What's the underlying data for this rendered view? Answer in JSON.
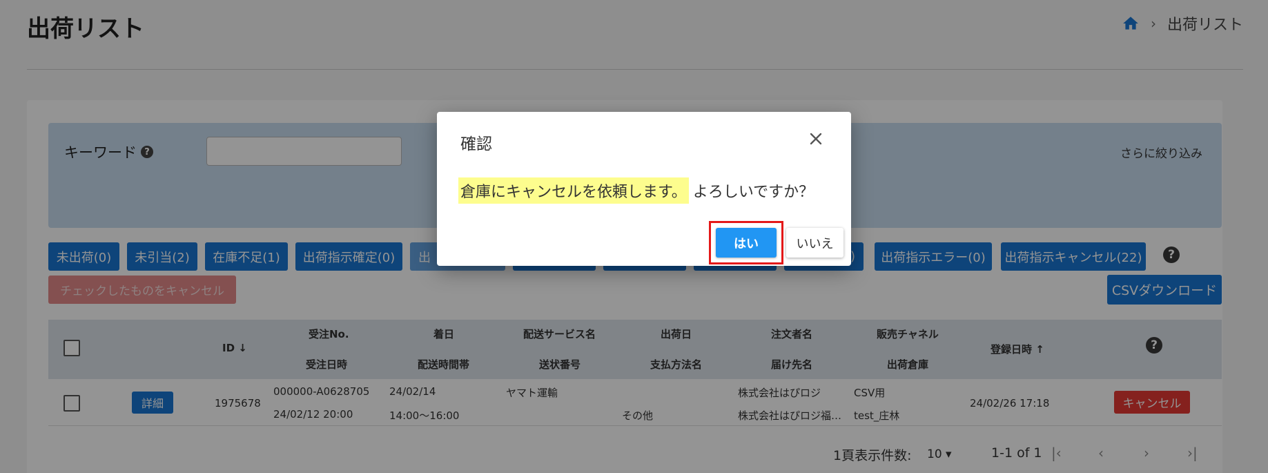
{
  "header": {
    "title": "出荷リスト",
    "breadcrumb": {
      "home_icon": "home-icon",
      "current": "出荷リスト"
    }
  },
  "search": {
    "keyword_label": "キーワード",
    "keyword_value": "",
    "more_filters": "さらに絞り込み"
  },
  "status_buttons": [
    "未出荷(0)",
    "未引当(2)",
    "在庫不足(1)",
    "出荷指示確定(0)",
    "出",
    "",
    "",
    "",
    ")",
    "出荷指示エラー(0)",
    "出荷指示キャンセル(22)"
  ],
  "toolbar": {
    "cancel_checked": "チェックしたものをキャンセル",
    "csv_download": "CSVダウンロード"
  },
  "table": {
    "headers": {
      "id": "ID",
      "order_no": "受注No.",
      "order_datetime": "受注日時",
      "arrival_date": "着日",
      "delivery_time": "配送時間帯",
      "service_name": "配送サービス名",
      "tracking_no": "送状番号",
      "ship_date": "出荷日",
      "payment": "支払方法名",
      "orderer": "注文者名",
      "recipient": "届け先名",
      "channel": "販売チャネル",
      "warehouse": "出荷倉庫",
      "registered": "登録日時"
    },
    "rows": [
      {
        "detail_label": "詳細",
        "id": "1975678",
        "order_no": "000000-A0628705",
        "order_datetime": "24/02/12 20:00",
        "arrival_date": "24/02/14",
        "delivery_time": "14:00～16:00",
        "service_name": "ヤマト運輸",
        "tracking_no": "",
        "ship_date": "",
        "payment": "その他",
        "orderer": "株式会社はぴロジ",
        "recipient": "株式会社はぴロジ福…",
        "channel": "CSV用",
        "warehouse": "test_庄林",
        "registered": "24/02/26 17:18",
        "cancel_label": "キャンセル"
      }
    ]
  },
  "pagination": {
    "per_page_label": "1頁表示件数:",
    "per_page_value": "10",
    "range": "1-1 of 1"
  },
  "dialog": {
    "title": "確認",
    "message_highlight": "倉庫にキャンセルを依頼します。",
    "message_rest": "よろしいですか？",
    "yes_label": "はい",
    "no_label": "いいえ",
    "highlight_color": "#fdfd8e",
    "frame_color": "#e41919"
  }
}
